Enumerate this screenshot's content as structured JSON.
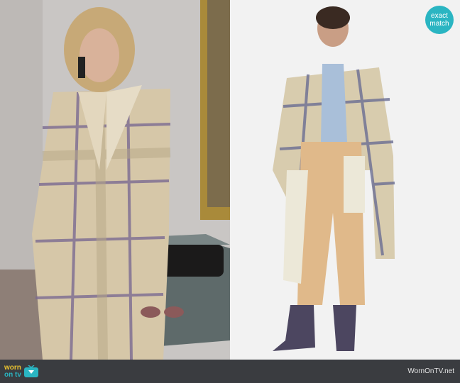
{
  "badge": {
    "line1": "exact",
    "line2": "match"
  },
  "footer": {
    "logo_top": "worn",
    "logo_bottom": "on tv",
    "site": "WornOnTV.net"
  },
  "colors": {
    "badge": "#2ab5c2",
    "footer": "#3a3c40",
    "logo_accent": "#e8c230"
  }
}
